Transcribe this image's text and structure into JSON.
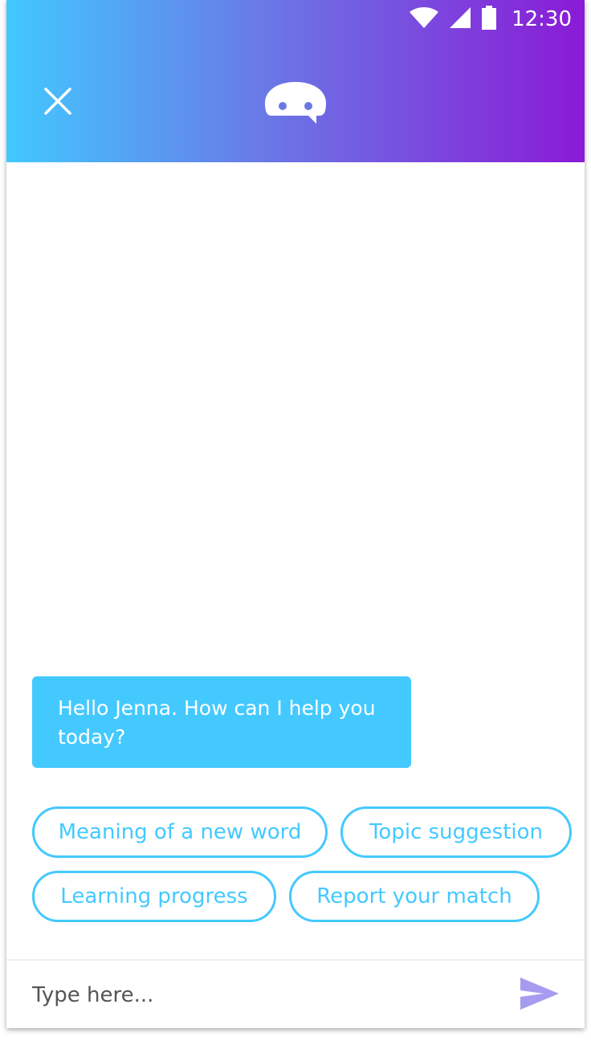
{
  "status_bar": {
    "time": "12:30",
    "icons": [
      "wifi-icon",
      "signal-icon",
      "battery-icon"
    ]
  },
  "header": {
    "close_icon": "close-icon",
    "logo_icon": "chat-bot-logo-icon",
    "gradient_start": "#42c8ff",
    "gradient_end": "#8a1ad6"
  },
  "chat": {
    "messages": [
      {
        "from": "bot",
        "text": "Hello Jenna. How can I help you today?"
      }
    ],
    "bubble_color": "#44c9ff"
  },
  "quick_replies": [
    {
      "label": "Meaning of a new word"
    },
    {
      "label": "Topic suggestion"
    },
    {
      "label": "Learning progress"
    },
    {
      "label": "Report your match"
    }
  ],
  "composer": {
    "placeholder": "Type here...",
    "send_icon": "send-icon",
    "send_color": "#a59cf0"
  }
}
